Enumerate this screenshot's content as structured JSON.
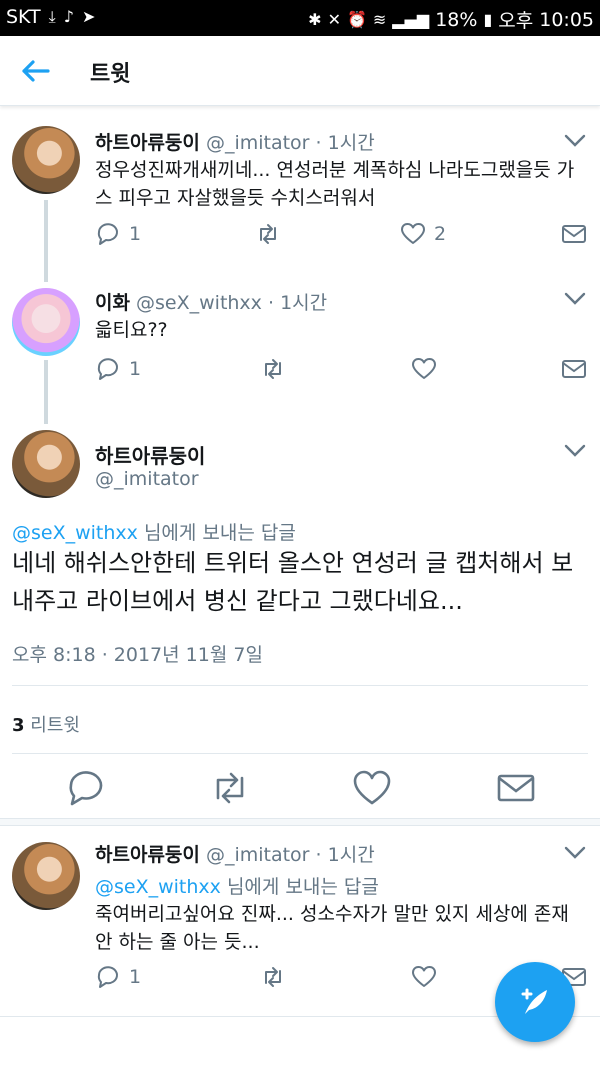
{
  "status_bar": {
    "carrier": "SKT",
    "battery": "18%",
    "ampm": "오후",
    "time": "10:05"
  },
  "header": {
    "title": "트윗"
  },
  "tweets": [
    {
      "name": "하트아류둥이",
      "handle": "@_imitator",
      "time": "1시간",
      "text": "정우성진짜개새끼네... 연성러분 계폭하심 나라도그랬을듯 가스 피우고 자살했을듯 수치스러워서",
      "replies": "1",
      "retweets": "",
      "likes": "2"
    },
    {
      "name": "이화",
      "handle": "@seX_withxx",
      "time": "1시간",
      "text": "읇티요??",
      "replies": "1",
      "retweets": "",
      "likes": ""
    }
  ],
  "focused": {
    "name": "하트아류둥이",
    "handle": "@_imitator",
    "reply_handle": "@seX_withxx",
    "reply_suffix": " 님에게 보내는 답글",
    "text": "네네 해쉬스안한테 트위터 올스안 연성러 글 캡처해서 보내주고 라이브에서 병신 같다고 그랬다네요...",
    "timestamp": "오후 8:18 · 2017년 11월 7일",
    "retweet_count": "3",
    "retweet_label": " 리트윗"
  },
  "reply_tweet": {
    "name": "하트아류둥이",
    "handle": "@_imitator",
    "time": "1시간",
    "reply_handle": "@seX_withxx",
    "reply_suffix": " 님에게 보내는 답글",
    "text": "죽여버리고싶어요 진짜... 성소수자가 말만 있지 세상에 존재 안 하는 줄 아는 듯...",
    "replies": "1"
  },
  "colors": {
    "accent": "#1da1f2",
    "text": "#14171a",
    "muted": "#657786",
    "divider": "#e1e8ed"
  },
  "icons": [
    "back-arrow-icon",
    "chevron-down-icon",
    "reply-icon",
    "retweet-icon",
    "like-icon",
    "share-icon",
    "compose-icon"
  ]
}
